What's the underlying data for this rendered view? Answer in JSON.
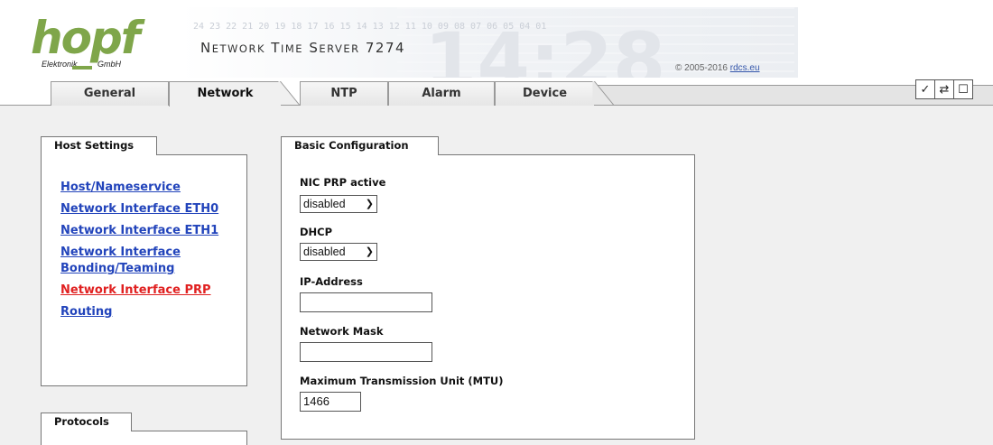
{
  "header": {
    "logo_word": "hopf",
    "logo_sub_left": "Elektronik",
    "logo_sub_right": "GmbH",
    "clock_digits": "24 23 22 21 20 19 18 17 16 15 14 13 12 11 10 09 08 07 06 05 04 01",
    "big_clock": "14:28",
    "product_title_prefix": "N",
    "product_title_rest1": "ETWORK",
    "product_title_t": "T",
    "product_title_rest2": "IME",
    "product_title_s": "S",
    "product_title_rest3": "ERVER",
    "product_model": "7274",
    "copyright_text": "© 2005-2016",
    "copyright_link": "rdcs.eu"
  },
  "tabs": [
    {
      "label": "General"
    },
    {
      "label": "Network",
      "active": true
    },
    {
      "label": "NTP"
    },
    {
      "label": "Alarm"
    },
    {
      "label": "Device"
    }
  ],
  "toolbar": {
    "icons": [
      "checkmark-icon",
      "refresh-icon",
      "page-icon"
    ],
    "check_glyph": "✓",
    "refresh_glyph": "⇄",
    "page_glyph": "☐"
  },
  "host_settings": {
    "title": "Host Settings",
    "links": [
      {
        "label": "Host/Nameservice"
      },
      {
        "label": "Network Interface ETH0"
      },
      {
        "label": "Network Interface ETH1"
      },
      {
        "label": "Network Interface Bonding/Teaming"
      },
      {
        "label": "Network Interface PRP",
        "active": true
      },
      {
        "label": "Routing"
      }
    ]
  },
  "protocols": {
    "title": "Protocols"
  },
  "basic_config": {
    "title": "Basic Configuration",
    "nic_prp_label": "NIC PRP active",
    "nic_prp_value": "disabled",
    "dhcp_label": "DHCP",
    "dhcp_value": "disabled",
    "ip_label": "IP-Address",
    "ip_value": "",
    "mask_label": "Network Mask",
    "mask_value": "",
    "mtu_label": "Maximum Transmission Unit (MTU)",
    "mtu_value": "1466"
  },
  "colors": {
    "logo_green": "#7fa64a",
    "link_blue": "#2244bb",
    "link_active_red": "#e02020",
    "content_bg": "#f0f0f0"
  }
}
